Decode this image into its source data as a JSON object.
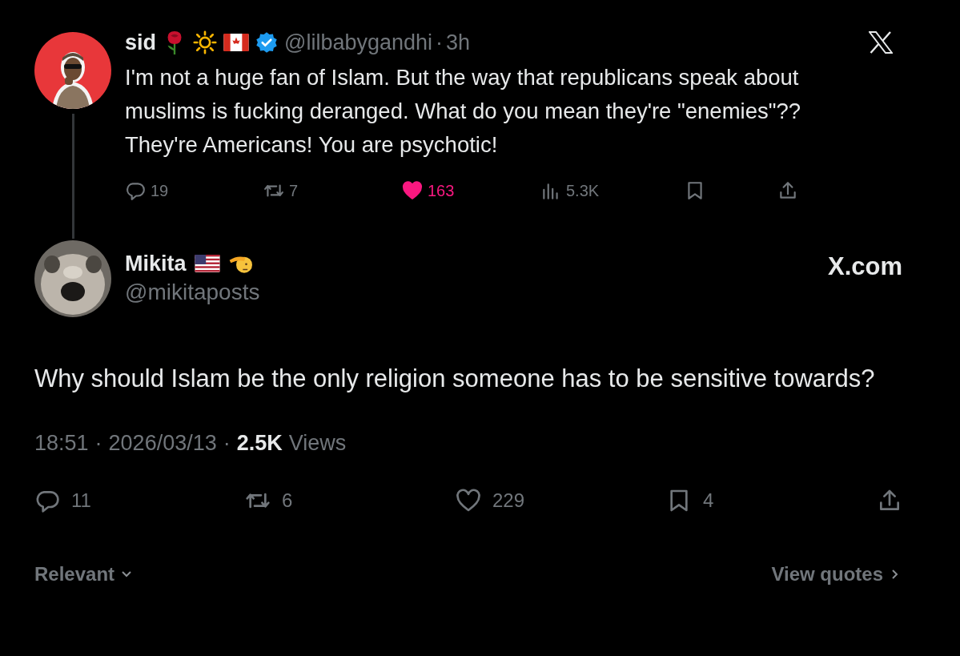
{
  "parent_post": {
    "author_name": "sid",
    "handle": "@lilbabygandhi",
    "separator": "·",
    "time": "3h",
    "text": "I'm not a huge fan of Islam. But the way that republicans speak about muslims is fucking deranged. What do you mean they're \"enemies\"?? They're Americans! You are psychotic!",
    "actions": [
      {
        "kind": "reply",
        "count": "19"
      },
      {
        "kind": "repost",
        "count": "7"
      },
      {
        "kind": "like",
        "count": "163",
        "selected": true
      },
      {
        "kind": "views",
        "count": "5.3K"
      },
      {
        "kind": "bookmark"
      },
      {
        "kind": "share"
      }
    ]
  },
  "post": {
    "author_name": "Mikita",
    "handle": "@mikitaposts",
    "site": "X.com",
    "text": "Why should Islam be the only religion someone has to be sensitive towards?",
    "time": "18:51",
    "separator_1": "·",
    "date": "2026/03/13",
    "separator_2": "·",
    "views_count": "2.5K",
    "views_label": "Views",
    "actions": [
      {
        "kind": "reply",
        "count": "11"
      },
      {
        "kind": "repost",
        "count": "6"
      },
      {
        "kind": "like",
        "count": "229",
        "selected": false
      },
      {
        "kind": "bookmark",
        "count": "4"
      },
      {
        "kind": "share"
      }
    ]
  },
  "footer": {
    "sort": "Relevant",
    "quotes_link": "View quotes"
  }
}
